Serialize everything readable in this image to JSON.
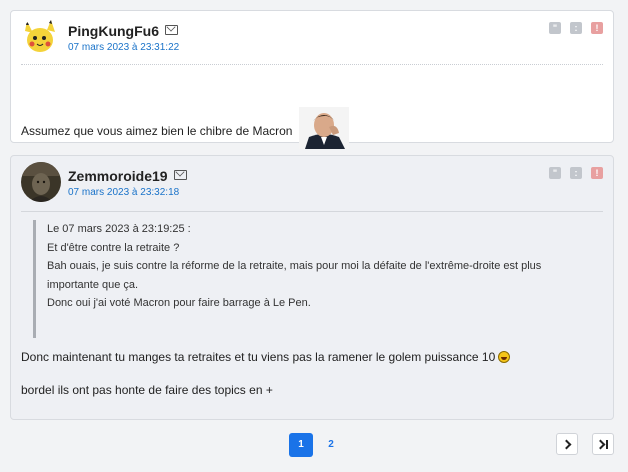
{
  "posts": [
    {
      "author": "PingKungFu6",
      "date": "07 mars 2023 à 23:31:22",
      "text": "Assumez que vous aimez bien le chibre de Macron"
    },
    {
      "author": "Zemmoroide19",
      "date": "07 mars 2023 à 23:32:18",
      "quote": {
        "header": "Le 07 mars 2023 à 23:19:25 :",
        "lines": [
          "Et d'être contre la retraite ?",
          "Bah ouais, je suis contre la réforme de la retraite, mais pour moi la défaite de l'extrême-droite est plus",
          "importante que ça.",
          "Donc oui j'ai voté Macron pour faire barrage à Le Pen."
        ]
      },
      "text_line1": "Donc maintenant tu manges ta retraites et tu viens pas la ramener le golem puissance 10",
      "text_line2": "bordel ils ont pas honte de faire des topics en +"
    }
  ],
  "pagination": {
    "pages": [
      "1",
      "2"
    ],
    "current": "1"
  },
  "colors": {
    "accent": "#1a73e8",
    "date": "#1a73c9",
    "alert": "#e8a0a0"
  },
  "icons": {
    "quote": "quote-icon",
    "mp": "message-icon",
    "alert": "alert-icon",
    "mail": "mail-icon",
    "next": "chevron-right-icon",
    "last": "last-page-icon"
  }
}
